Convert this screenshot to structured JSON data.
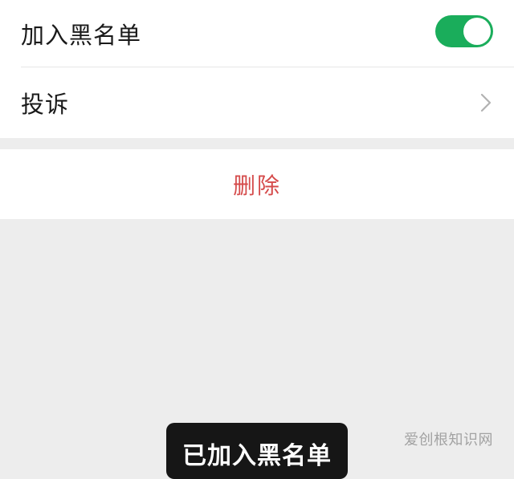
{
  "settings": {
    "blacklist": {
      "label": "加入黑名单",
      "toggle_on": true,
      "toggle_color": "#1aad5b"
    },
    "complain": {
      "label": "投诉",
      "icon": "chevron-right-icon"
    }
  },
  "delete": {
    "label": "删除",
    "color": "#d54b4b"
  },
  "toast": {
    "text": "已加入黑名单"
  },
  "watermark": {
    "text": "爱创根知识网"
  }
}
